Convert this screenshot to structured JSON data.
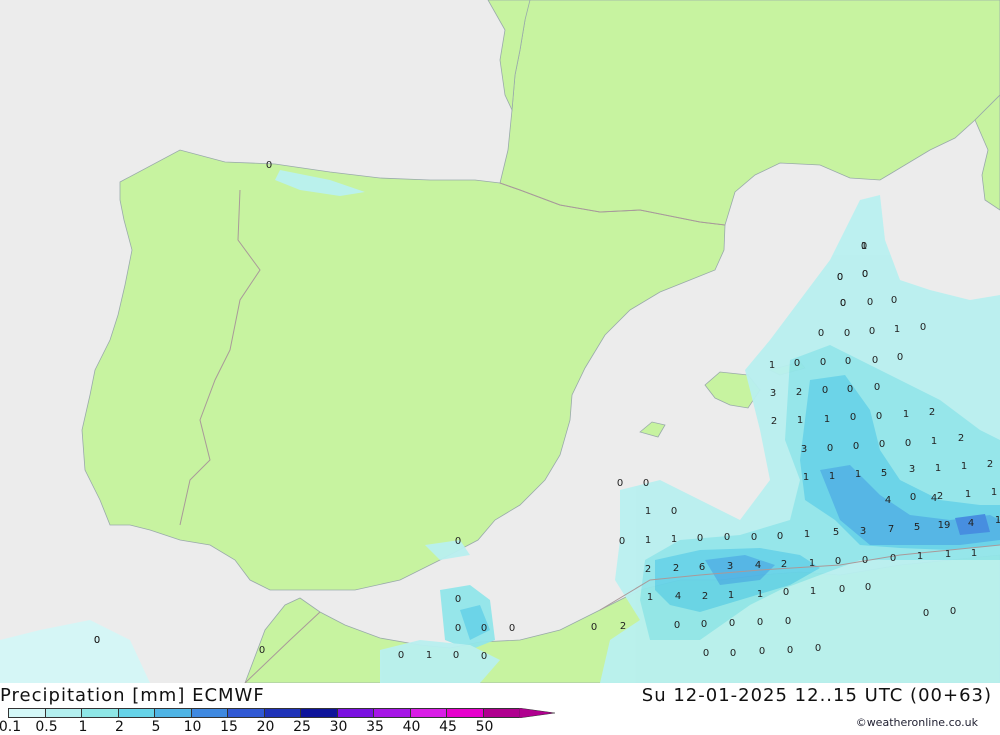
{
  "map": {
    "land_color": "#c7f3a0",
    "sea_color": "#ececec",
    "border_color": "#a99999",
    "labels": [
      {
        "t": "0"
      },
      {
        "t": "1"
      },
      {
        "t": "0"
      },
      {
        "t": "0"
      },
      {
        "t": "0"
      },
      {
        "t": "0"
      },
      {
        "t": "0"
      },
      {
        "t": "0"
      },
      {
        "t": "0"
      },
      {
        "t": "0"
      },
      {
        "t": "1"
      },
      {
        "t": "0"
      },
      {
        "t": "1"
      },
      {
        "t": "0"
      },
      {
        "t": "0"
      },
      {
        "t": "0"
      },
      {
        "t": "0"
      },
      {
        "t": "0"
      },
      {
        "t": "3"
      },
      {
        "t": "2"
      },
      {
        "t": "0"
      },
      {
        "t": "0"
      },
      {
        "t": "0"
      },
      {
        "t": "2"
      },
      {
        "t": "1"
      },
      {
        "t": "1"
      },
      {
        "t": "0"
      },
      {
        "t": "0"
      },
      {
        "t": "1"
      },
      {
        "t": "2"
      },
      {
        "t": "3"
      },
      {
        "t": "0"
      },
      {
        "t": "0"
      },
      {
        "t": "0"
      },
      {
        "t": "0"
      },
      {
        "t": "1"
      },
      {
        "t": "2"
      },
      {
        "t": "1"
      },
      {
        "t": "2"
      },
      {
        "t": "3"
      },
      {
        "t": "1"
      },
      {
        "t": "1"
      },
      {
        "t": "1"
      },
      {
        "t": "1"
      },
      {
        "t": "5"
      },
      {
        "t": "4"
      },
      {
        "t": "4"
      },
      {
        "t": "0"
      },
      {
        "t": "2"
      },
      {
        "t": "1"
      },
      {
        "t": "1"
      },
      {
        "t": "0"
      },
      {
        "t": "0"
      },
      {
        "t": "1"
      },
      {
        "t": "0"
      },
      {
        "t": "0"
      },
      {
        "t": "1"
      },
      {
        "t": "1"
      },
      {
        "t": "0"
      },
      {
        "t": "0"
      },
      {
        "t": "0"
      },
      {
        "t": "0"
      },
      {
        "t": "1"
      },
      {
        "t": "5"
      },
      {
        "t": "3"
      },
      {
        "t": "7"
      },
      {
        "t": "5"
      },
      {
        "t": "19"
      },
      {
        "t": "4"
      },
      {
        "t": "1"
      },
      {
        "t": "2"
      },
      {
        "t": "2"
      },
      {
        "t": "6"
      },
      {
        "t": "3"
      },
      {
        "t": "4"
      },
      {
        "t": "2"
      },
      {
        "t": "1"
      },
      {
        "t": "0"
      },
      {
        "t": "0"
      },
      {
        "t": "0"
      },
      {
        "t": "1"
      },
      {
        "t": "1"
      },
      {
        "t": "1"
      },
      {
        "t": "1"
      },
      {
        "t": "4"
      },
      {
        "t": "2"
      },
      {
        "t": "1"
      },
      {
        "t": "1"
      },
      {
        "t": "0"
      },
      {
        "t": "1"
      },
      {
        "t": "0"
      },
      {
        "t": "0"
      },
      {
        "t": "0"
      },
      {
        "t": "0"
      },
      {
        "t": "0"
      },
      {
        "t": "0"
      },
      {
        "t": "0"
      },
      {
        "t": "2"
      },
      {
        "t": "0"
      },
      {
        "t": "0"
      },
      {
        "t": "0"
      },
      {
        "t": "0"
      },
      {
        "t": "0"
      },
      {
        "t": "0"
      },
      {
        "t": "0"
      },
      {
        "t": "0"
      },
      {
        "t": "1"
      },
      {
        "t": "0"
      },
      {
        "t": "0"
      },
      {
        "t": "0"
      },
      {
        "t": "0"
      },
      {
        "t": "0"
      },
      {
        "t": "0"
      },
      {
        "t": "0"
      },
      {
        "t": "0"
      },
      {
        "t": "0"
      },
      {
        "t": "0"
      },
      {
        "t": "0"
      },
      {
        "t": "0"
      },
      {
        "t": "0"
      },
      {
        "t": "0"
      },
      {
        "t": "0"
      }
    ]
  },
  "footer": {
    "title_left": "Precipitation [mm] ECMWF",
    "title_right": "Su 12-01-2025 12..15 UTC (00+63)",
    "credit": "©weatheronline.co.uk",
    "scale": [
      {
        "label": "0.1",
        "color": "#d4f7f7"
      },
      {
        "label": "0.5",
        "color": "#b3efef"
      },
      {
        "label": "1",
        "color": "#8ee6e6"
      },
      {
        "label": "2",
        "color": "#66d3e8"
      },
      {
        "label": "5",
        "color": "#4fb4e5"
      },
      {
        "label": "10",
        "color": "#3f89e0"
      },
      {
        "label": "15",
        "color": "#3159d4"
      },
      {
        "label": "20",
        "color": "#1f33b8"
      },
      {
        "label": "25",
        "color": "#0e149a"
      },
      {
        "label": "30",
        "color": "#7a10e0"
      },
      {
        "label": "35",
        "color": "#a615e6"
      },
      {
        "label": "40",
        "color": "#d91de6"
      },
      {
        "label": "45",
        "color": "#e600cc"
      },
      {
        "label": "50",
        "color": "#b0008f"
      }
    ]
  }
}
